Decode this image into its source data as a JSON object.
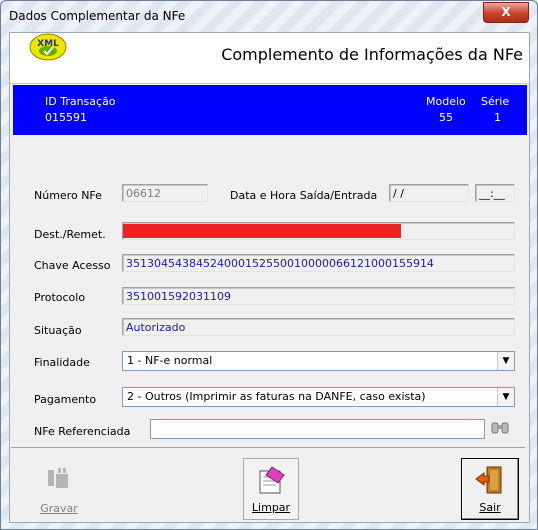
{
  "window": {
    "title": "Dados Complementar da NFe",
    "close_label": "X"
  },
  "header": {
    "icon_text": "XML",
    "title": "Complemento de Informações da NFe"
  },
  "transaction": {
    "id_label": "ID Transação",
    "id_value": "015591",
    "modelo_label": "Modelo",
    "modelo_value": "55",
    "serie_label": "Série",
    "serie_value": "1",
    "panel_color": "#0000ff"
  },
  "form": {
    "numero_label": "Número NFe",
    "numero_value": "06612",
    "data_label": "Data e Hora Saída/Entrada",
    "data_value": " / /",
    "hora_value": "__:__",
    "dest_label": "Dest./Remet.",
    "dest_redaction_color": "#ee2222",
    "chave_label": "Chave Acesso",
    "chave_value": "35130454384524000152550010000066121000155914",
    "protocolo_label": "Protocolo",
    "protocolo_value": "351001592031109",
    "situacao_label": "Situação",
    "situacao_value": "Autorizado",
    "finalidade_label": "Finalidade",
    "finalidade_value": "1 - NF-e normal",
    "pagamento_label": "Pagamento",
    "pagamento_value": "2 - Outros (Imprimir as faturas na DANFE, caso exista)",
    "referenciada_label": "NFe Referenciada",
    "referenciada_value": ""
  },
  "buttons": {
    "gravar": "Gravar",
    "limpar": "Limpar",
    "sair": "Sair"
  }
}
